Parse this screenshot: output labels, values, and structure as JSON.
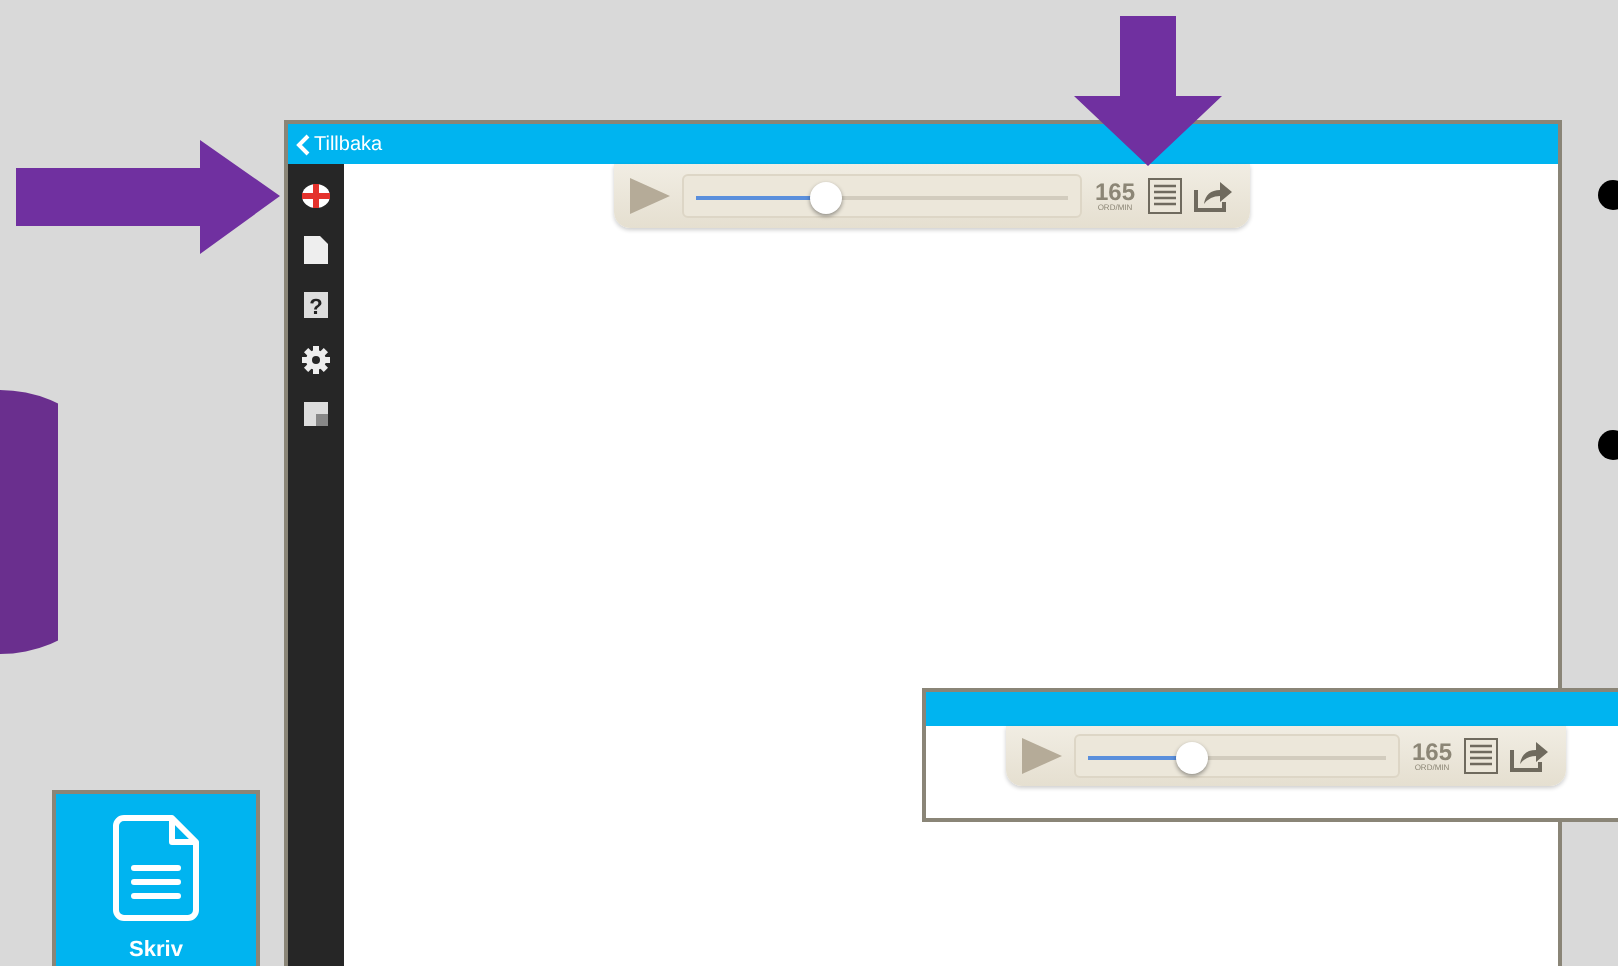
{
  "app": {
    "back_button": "Tillbaka",
    "help_mark": "?",
    "player": {
      "level": 0.35,
      "speed": "165",
      "unit": "ORD/MIN"
    }
  },
  "inset": {
    "player": {
      "level": 0.35,
      "speed": "165",
      "unit": "ORD/MIN"
    }
  },
  "tile": {
    "label": "Skriv"
  }
}
